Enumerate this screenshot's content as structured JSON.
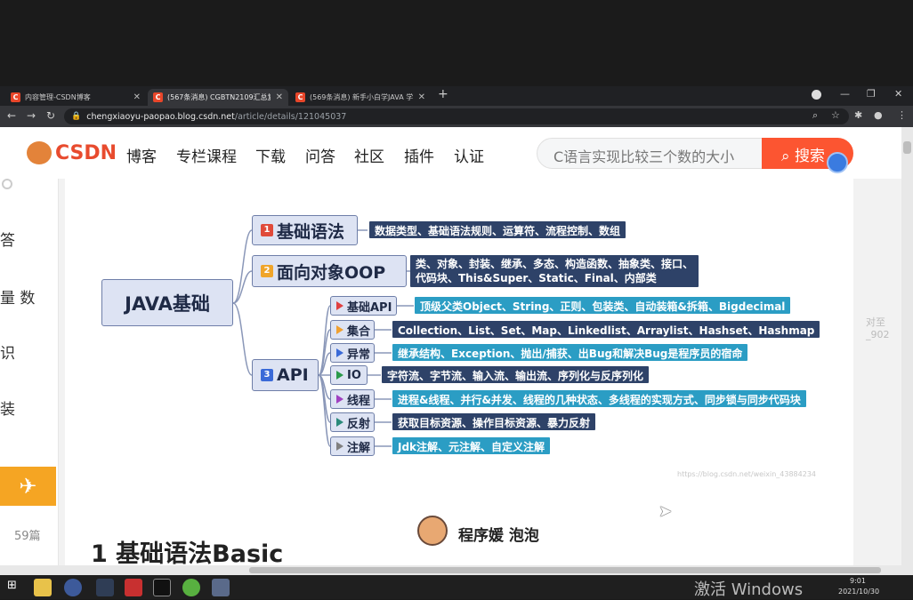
{
  "browser": {
    "tabs": [
      {
        "favicon": "C",
        "label": "内容管理-CSDN博客"
      },
      {
        "favicon": "C",
        "label": "(567条消息) CGBTN2109汇总复"
      },
      {
        "favicon": "C",
        "label": "(569条消息) 新手小白学JAVA 学"
      }
    ],
    "new_tab": "+",
    "url_domain": "chengxiaoyu-paopao.blog.csdn.net",
    "url_path": "/article/details/121045037"
  },
  "site": {
    "logo_text": "CSDN",
    "nav": [
      "博客",
      "专栏课程",
      "下载",
      "问答",
      "社区",
      "插件",
      "认证"
    ],
    "search_placeholder": "C语言实现比较三个数的大小",
    "search_button": "搜索"
  },
  "sidebar": {
    "items": [
      "答",
      "量 数",
      "识",
      "装"
    ],
    "count": "59篇"
  },
  "mindmap": {
    "root": "JAVA基础",
    "branches": [
      {
        "num": "1",
        "label": "基础语法",
        "color": "#e04a3a",
        "leaf": "数据类型、基础语法规则、运算符、流程控制、数组"
      },
      {
        "num": "2",
        "label": "面向对象OOP",
        "color": "#f0a52a",
        "leaf_lines": [
          "类、对象、封装、继承、多态、构造函数、抽象类、接口、",
          "代码块、This&Super、Static、Final、内部类"
        ]
      },
      {
        "num": "3",
        "label": "API"
      }
    ],
    "api_children": [
      {
        "label": "基础API",
        "flag": "#e04040",
        "leaf": "顶级父类Object、String、正则、包装类、自动装箱&拆箱、Bigdecimal"
      },
      {
        "label": "集合",
        "flag": "#f0a030",
        "leaf": "Collection、List、Set、Map、Linkedlist、Arraylist、Hashset、Hashmap"
      },
      {
        "label": "异常",
        "flag": "#3a6ad8",
        "leaf": "继承结构、Exception、抛出/捕获、出Bug和解决Bug是程序员的宿命"
      },
      {
        "label": "IO",
        "flag": "#2a9a4a",
        "leaf": "字符流、字节流、输入流、输出流、序列化与反序列化"
      },
      {
        "label": "线程",
        "flag": "#a040c0",
        "leaf": "进程&线程、并行&并发、线程的几种状态、多线程的实现方式、同步锁与同步代码块"
      },
      {
        "label": "反射",
        "flag": "#2a8a7a",
        "leaf": "获取目标资源、操作目标资源、暴力反射"
      },
      {
        "label": "注解",
        "flag": "#808080",
        "leaf": "Jdk注解、元注解、自定义注解"
      }
    ],
    "watermark": "https://blog.csdn.net/weixin_43884234"
  },
  "article": {
    "heading": "1 基础语法Basic",
    "author": "程序媛 泡泡",
    "side_label": "对至_902"
  },
  "taskbar": {
    "activate_watermark": "激活 Windows",
    "time": "9:01",
    "date": "2021/10/30"
  }
}
